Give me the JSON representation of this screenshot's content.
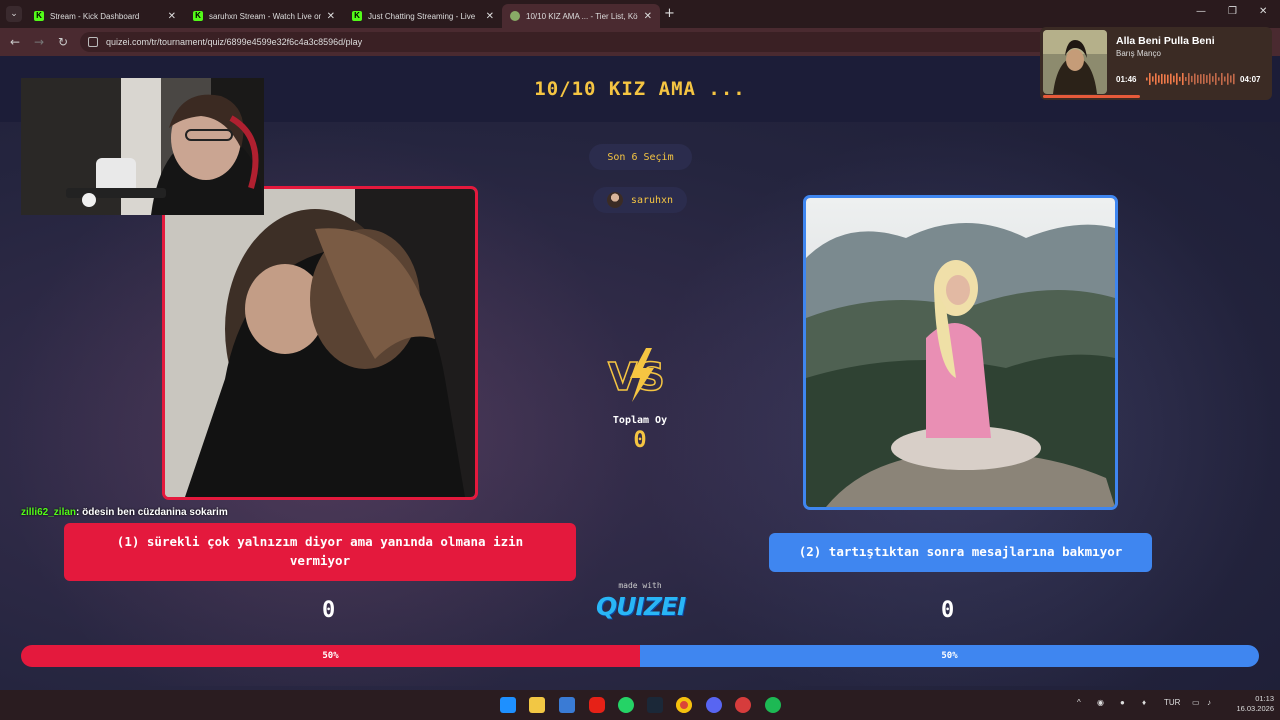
{
  "browser": {
    "tabs": [
      {
        "title": "Stream - Kick Dashboard",
        "icon": "kick-icon",
        "active": false
      },
      {
        "title": "saruhxn Stream - Watch Live on",
        "icon": "kick-icon",
        "active": false
      },
      {
        "title": "Just Chatting Streaming - Live",
        "icon": "kick-icon",
        "active": false
      },
      {
        "title": "10/10 KIZ AMA ... - Tier List, Kö",
        "icon": "quizei-icon",
        "active": true
      }
    ],
    "url": "quizei.com/tr/tournament/quiz/6899e4599e32f6c4a3c8596d/play"
  },
  "quiz": {
    "title": "10/10 KIZ AMA ...",
    "round_label": "Son 6 Seçim",
    "player_name": "saruhxn",
    "total_label": "Toplam Oy",
    "total_votes": "0",
    "made_with": "made with",
    "brand": "QUIZEI",
    "options": [
      {
        "text": "(1) sürekli çok yalnızım diyor ama yanında olmana izin vermiyor",
        "votes": "0",
        "percent_label": "50%",
        "percent": 50,
        "color": "#e4193d"
      },
      {
        "text": "(2) tartıştıktan sonra mesajlarına bakmıyor",
        "votes": "0",
        "percent_label": "50%",
        "percent": 50,
        "color": "#3f86f0"
      }
    ]
  },
  "chat": {
    "user": "zilli62_zilan",
    "message": ": ödesin ben cüzdanina sokarim"
  },
  "music": {
    "song": "Alla Beni Pulla Beni",
    "artist": "Barış Manço",
    "elapsed": "01:46",
    "duration": "04:07",
    "progress": 0.43
  },
  "taskbar": {
    "language": "TUR",
    "time": "01:13",
    "date": "16.03.2026"
  }
}
